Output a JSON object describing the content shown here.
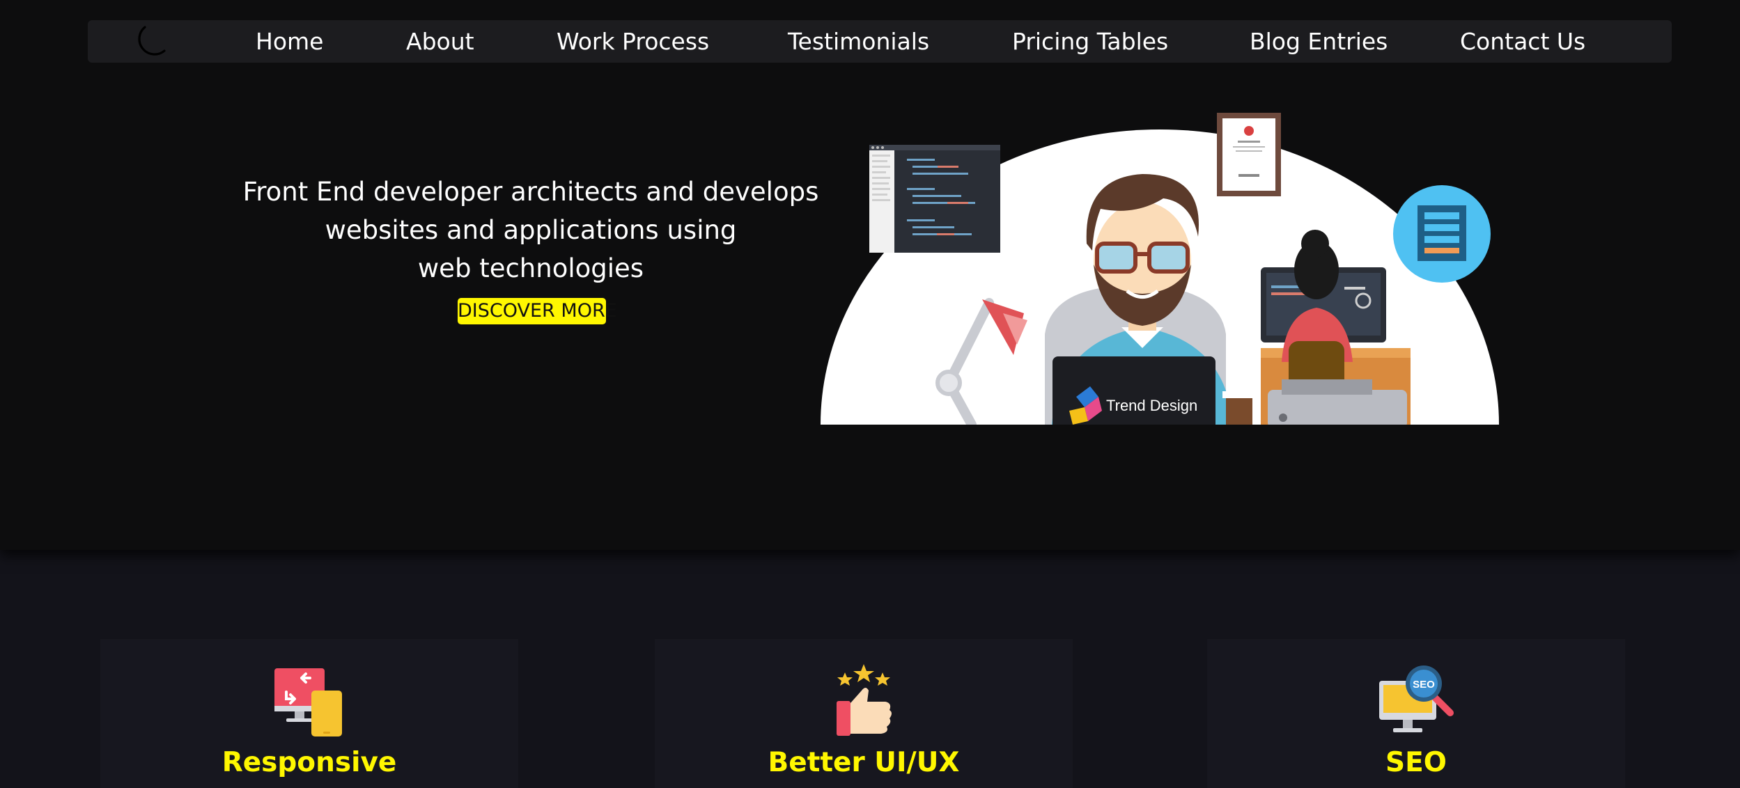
{
  "theme_toggle": {
    "icon": "moon-icon"
  },
  "nav": {
    "home": "Home",
    "about": "About",
    "work_process": "Work Process",
    "testimonials": "Testimonials",
    "pricing_tables": "Pricing Tables",
    "blog_entries": "Blog Entries",
    "contact_us": "Contact Us"
  },
  "hero": {
    "line1": "Front End developer architects and develops",
    "line2": "websites and applications using",
    "line3": "web technologies",
    "cta": "DISCOVER MORE",
    "laptop_brand": "Trend Design",
    "badge": "SEO"
  },
  "features": [
    {
      "title": "Responsive",
      "icon": "responsive-devices-icon"
    },
    {
      "title": "Better UI/UX",
      "icon": "thumbs-up-stars-icon"
    },
    {
      "title": "SEO",
      "icon": "seo-monitor-icon"
    }
  ],
  "colors": {
    "accent": "#fff700",
    "hero_bg": "#0d0d0e",
    "page_bg": "#13131a",
    "navbar_bg": "#1c1c1f"
  }
}
